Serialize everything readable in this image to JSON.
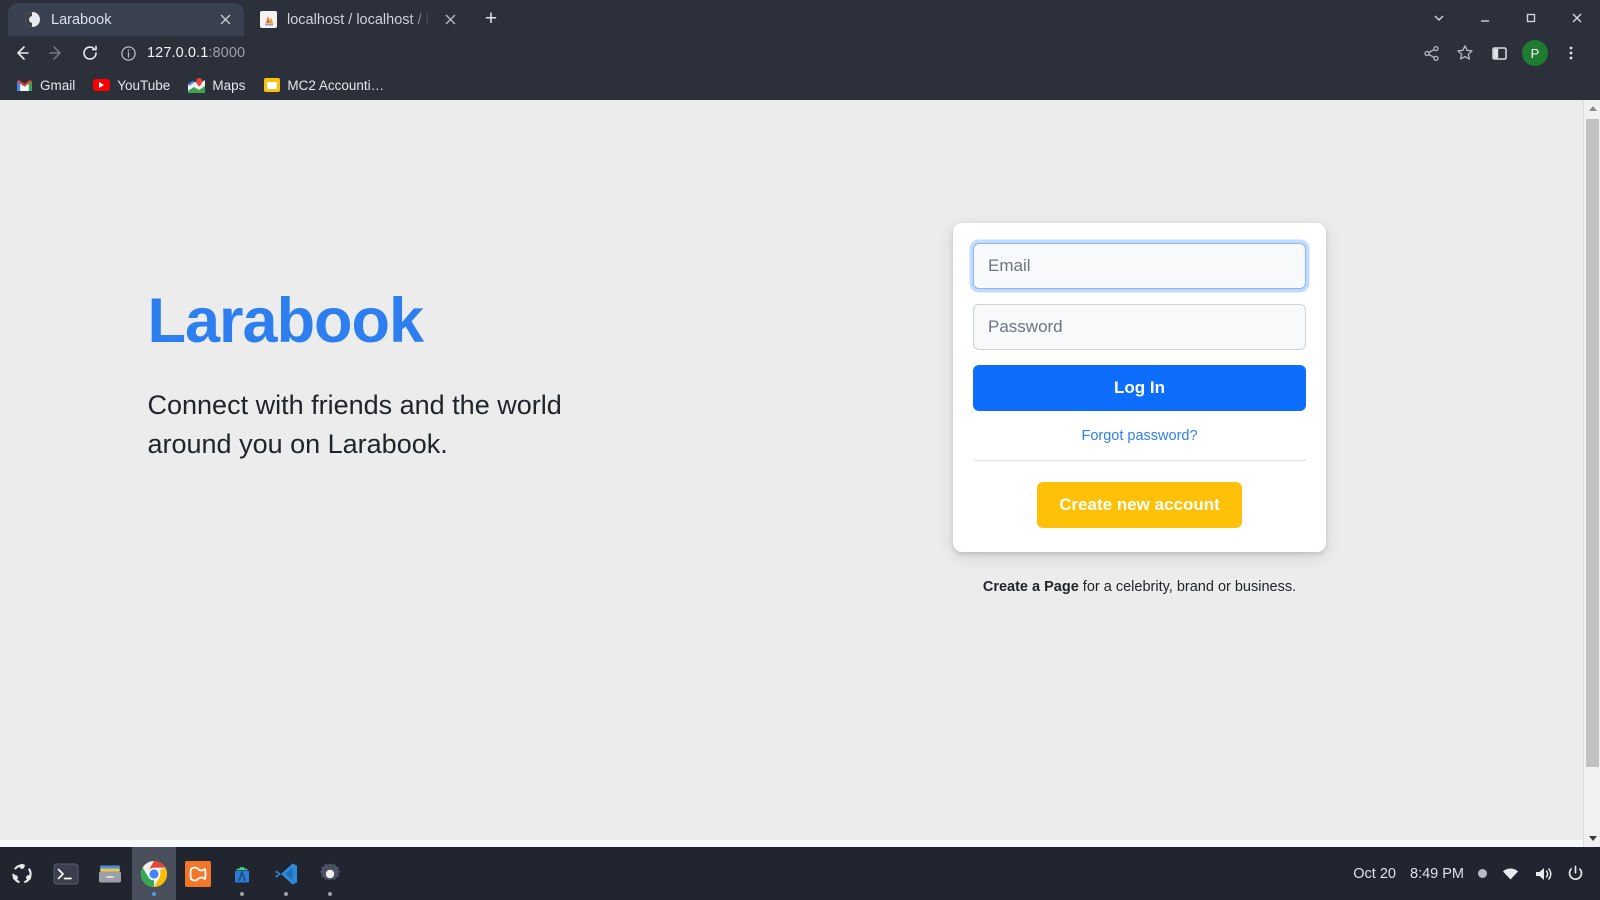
{
  "browser": {
    "tabs": [
      {
        "title": "Larabook",
        "favicon": "globe-icon",
        "active": true
      },
      {
        "title": "localhost / localhost / lara",
        "favicon": "phpmyadmin-icon",
        "active": false
      }
    ],
    "new_tab_label": "+",
    "window_controls": [
      "chevron-down-icon",
      "minimize-icon",
      "maximize-icon",
      "close-icon"
    ],
    "toolbar": {
      "back_label": "back-icon",
      "forward_label": "forward-icon",
      "reload_label": "reload-icon",
      "site_info_label": "info-icon",
      "url_host": "127.0.0.1",
      "url_port": ":8000",
      "right_icons": [
        "share-icon",
        "bookmark-star-icon",
        "side-panel-icon",
        "profile-avatar",
        "three-dot-menu-icon"
      ],
      "avatar_initial": "P"
    },
    "bookmarks": [
      {
        "label": "Gmail",
        "icon": "gmail-icon"
      },
      {
        "label": "YouTube",
        "icon": "youtube-icon"
      },
      {
        "label": "Maps",
        "icon": "maps-icon"
      },
      {
        "label": "MC2 Accounti…",
        "icon": "folder-icon"
      }
    ]
  },
  "page": {
    "hero": {
      "title": "Larabook",
      "subtitle": "Connect with friends and the world around you on Larabook."
    },
    "login": {
      "email_placeholder": "Email",
      "email_value": "",
      "password_placeholder": "Password",
      "password_value": "",
      "login_button": "Log In",
      "forgot_link": "Forgot password?",
      "create_account_button": "Create new account"
    },
    "create_page_note": {
      "bold": "Create a Page",
      "rest": " for a celebrity, brand or business."
    }
  },
  "colors": {
    "brand_blue": "#2d7ff0",
    "button_blue": "#0d6efd",
    "accent_yellow": "#ffc107",
    "page_background": "#ececec",
    "card_background": "#ffffff",
    "chrome_background": "#2b303b",
    "taskbar_background": "#212530",
    "avatar_green": "#1e7b2f"
  },
  "taskbar": {
    "apps": [
      {
        "name": "ubuntu-show-apps",
        "dot": false,
        "active": false
      },
      {
        "name": "terminal",
        "dot": false,
        "active": false
      },
      {
        "name": "files",
        "dot": false,
        "active": false
      },
      {
        "name": "google-chrome",
        "dot": true,
        "active": true
      },
      {
        "name": "orange-app",
        "dot": false,
        "active": false
      },
      {
        "name": "android-studio",
        "dot": true,
        "active": false
      },
      {
        "name": "vs-code",
        "dot": true,
        "active": false
      },
      {
        "name": "settings",
        "dot": true,
        "active": false
      }
    ],
    "tray": {
      "date": "Oct 20",
      "time": "8:49 PM",
      "icons": [
        "record-dot-icon",
        "wifi-icon",
        "volume-icon",
        "power-icon"
      ]
    }
  }
}
